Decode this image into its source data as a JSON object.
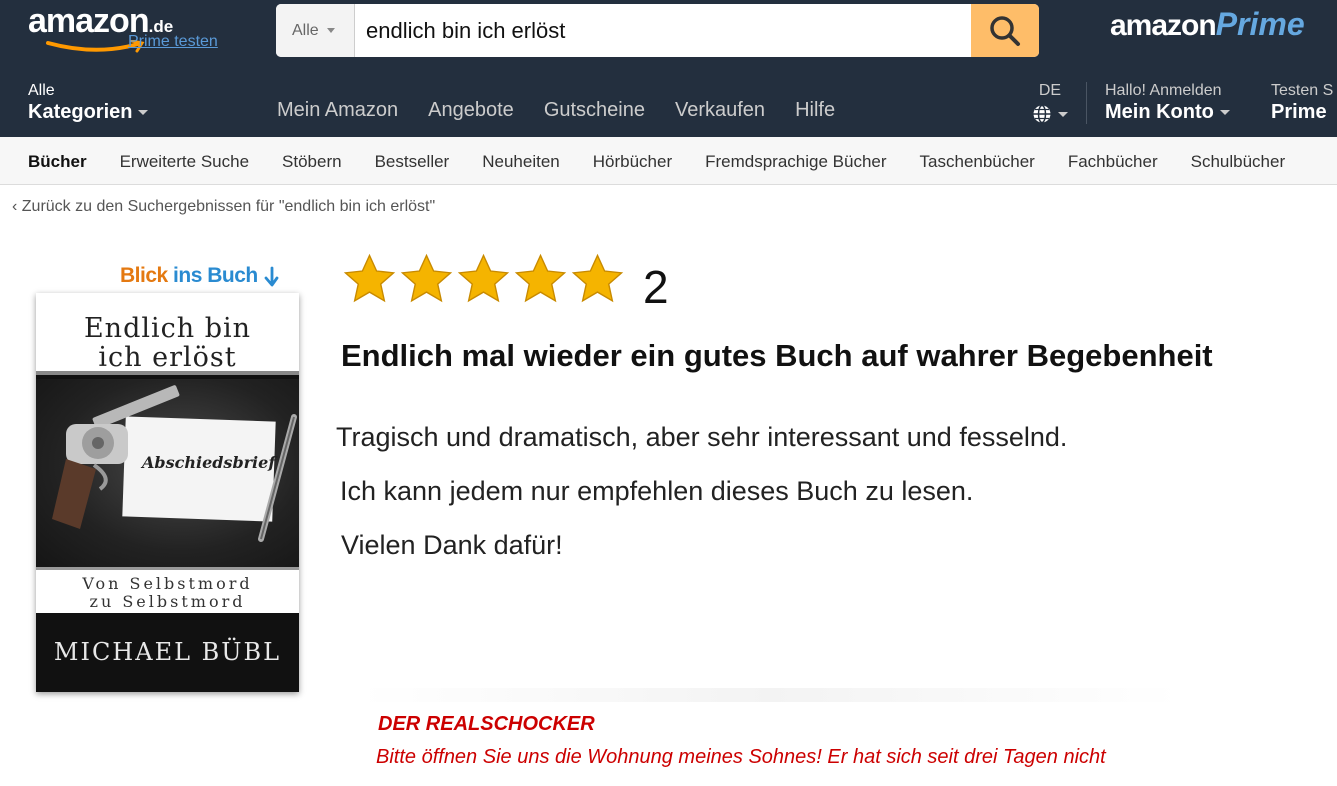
{
  "header": {
    "logo_text": "amazon",
    "logo_tld": ".de",
    "prime_trial_link": "Prime testen",
    "search": {
      "category": "Alle",
      "value": "endlich bin ich erlöst"
    },
    "prime_logo_amazon": "amazon",
    "prime_logo_prime": "Prime",
    "all_categories_small": "Alle",
    "all_categories_big": "Kategorien",
    "nav_links": [
      "Mein Amazon",
      "Angebote",
      "Gutscheine",
      "Verkaufen",
      "Hilfe"
    ],
    "language": "DE",
    "account_small": "Hallo! Anmelden",
    "account_big": "Mein Konto",
    "try_small": "Testen S",
    "try_big": "Prime"
  },
  "subnav": {
    "items": [
      "Bücher",
      "Erweiterte Suche",
      "Stöbern",
      "Bestseller",
      "Neuheiten",
      "Hörbücher",
      "Fremdsprachige Bücher",
      "Taschenbücher",
      "Fachbücher",
      "Schulbücher"
    ]
  },
  "back_link": "Zurück zu den Suchergebnissen für \"endlich bin ich erlöst\"",
  "book": {
    "look_inside_a": "Blick ",
    "look_inside_b": "ins Buch",
    "title_line1": "Endlich bin",
    "title_line2": "ich erlöst",
    "note_label": "Abschiedsbrief",
    "subtitle_line1": "Von Selbstmord",
    "subtitle_line2": "zu Selbstmord",
    "author": "MICHAEL BÜBL"
  },
  "review": {
    "stars": 5,
    "count": "2",
    "title": "Endlich mal wieder ein gutes Buch auf wahrer Begebenheit",
    "line1": "Tragisch und dramatisch, aber sehr interessant und fesselnd.",
    "line2": "Ich kann jedem nur empfehlen dieses Buch zu lesen.",
    "line3": "Vielen Dank dafür!"
  },
  "promo": {
    "title": "DER REALSCHOCKER",
    "text": "Bitte öffnen Sie uns die Wohnung meines Sohnes! Er hat sich seit drei Tagen nicht"
  },
  "colors": {
    "header_bg": "#232f3e",
    "search_button": "#febd69",
    "star": "#f5b400",
    "promo_red": "#cc0000"
  }
}
